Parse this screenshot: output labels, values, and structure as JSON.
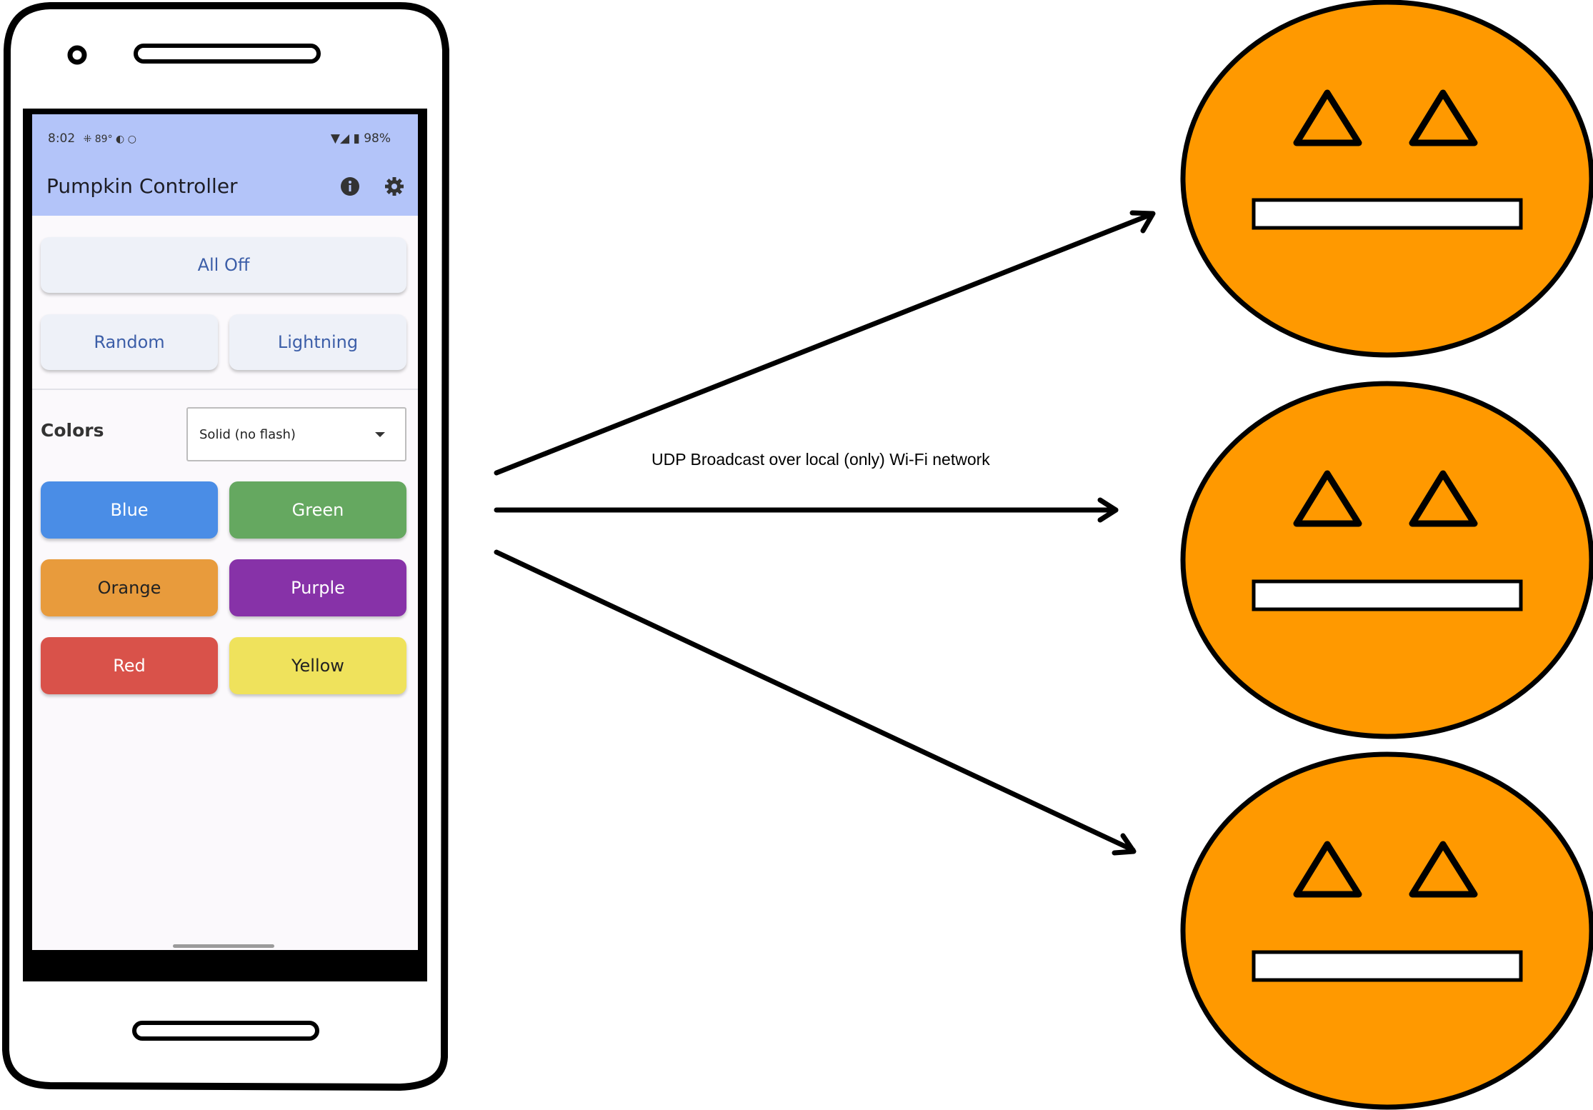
{
  "status_bar": {
    "time": "8:02",
    "left_icons": "⁜ 89° ◐ ○",
    "right_icons": "▼◢ ▮ 98%"
  },
  "app_bar": {
    "title": "Pumpkin Controller",
    "icons": [
      "info-icon",
      "gear-icon"
    ]
  },
  "buttons": {
    "all_off": "All Off",
    "random": "Random",
    "lightning": "Lightning"
  },
  "colors": {
    "label": "Colors",
    "mode_selected": "Solid (no flash)",
    "color_buttons": [
      {
        "label": "Blue",
        "bg": "#4a8de6",
        "fg": "#ffffff"
      },
      {
        "label": "Green",
        "bg": "#65a860",
        "fg": "#ffffff"
      },
      {
        "label": "Orange",
        "bg": "#e89b3c",
        "fg": "#222222"
      },
      {
        "label": "Purple",
        "bg": "#8732a8",
        "fg": "#ffffff"
      },
      {
        "label": "Red",
        "bg": "#d9524a",
        "fg": "#ffffff"
      },
      {
        "label": "Yellow",
        "bg": "#efe25c",
        "fg": "#222222"
      }
    ]
  },
  "diagram": {
    "network_label": "UDP Broadcast over local (only) Wi-Fi network",
    "pumpkin_color": "#ff9900",
    "pumpkin_count": 3
  }
}
